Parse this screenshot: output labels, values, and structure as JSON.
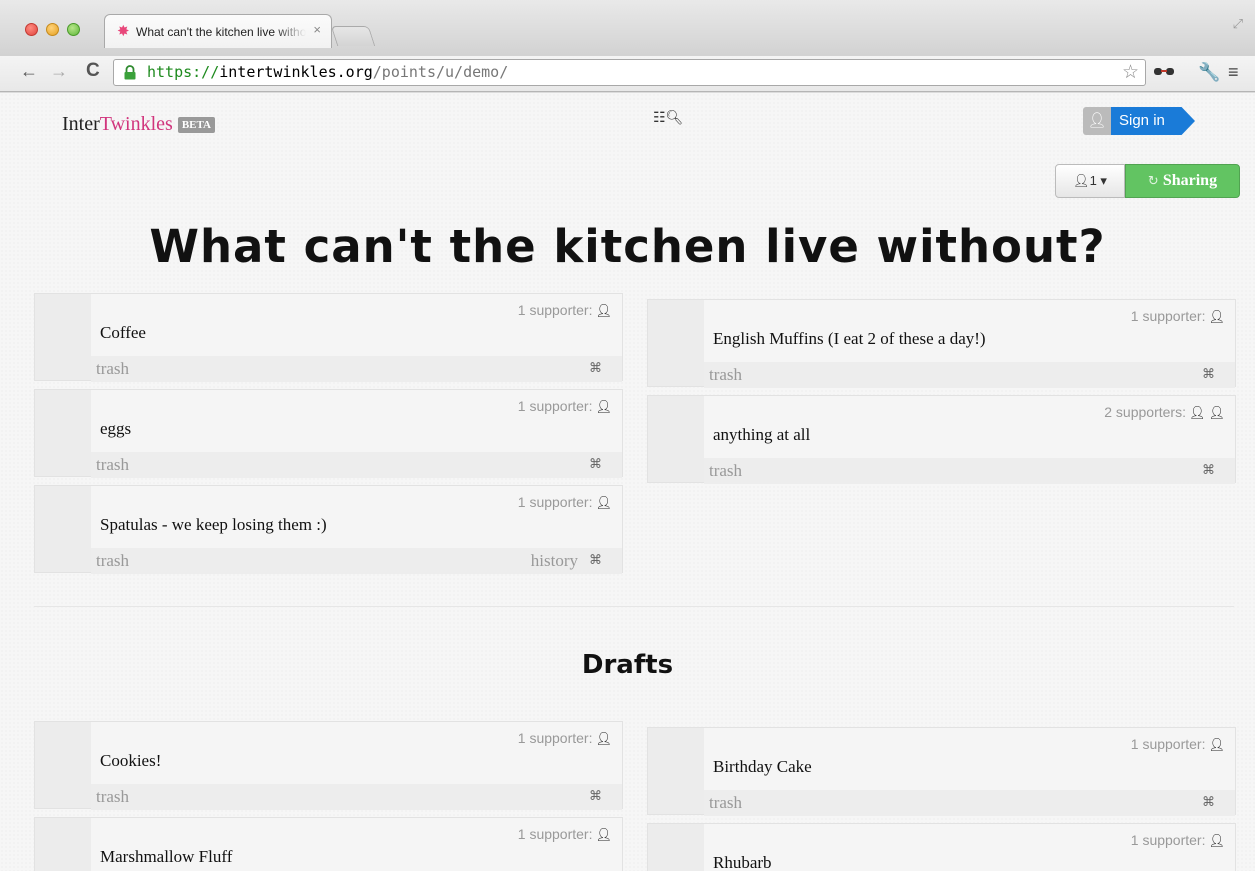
{
  "browser": {
    "tab_title": "What can't the kitchen live without?",
    "tab_close": "×",
    "url_scheme": "https://",
    "url_host": "intertwinkles.org",
    "url_path": "/points/u/demo/"
  },
  "header": {
    "brand_inter": "Inter",
    "brand_twinkles": "Twinkles",
    "beta_badge": "BETA",
    "sign_in": "Sign in",
    "users_count": "1",
    "sharing_label": "Sharing"
  },
  "main": {
    "title": "What can't the kitchen live without?",
    "drafts_title": "Drafts"
  },
  "labels": {
    "trash": "trash",
    "history": "history"
  },
  "approved_points": [
    {
      "text": "Coffee",
      "supporters": "1 supporter:",
      "count": 1,
      "history": false
    },
    {
      "text": "English Muffins (I eat 2 of these a day!)",
      "supporters": "1 supporter:",
      "count": 1,
      "history": false
    },
    {
      "text": "eggs",
      "supporters": "1 supporter:",
      "count": 1,
      "history": false
    },
    {
      "text": "anything at all",
      "supporters": "2 supporters:",
      "count": 2,
      "history": false
    },
    {
      "text": "Spatulas - we keep losing them :)",
      "supporters": "1 supporter:",
      "count": 1,
      "history": true
    }
  ],
  "draft_points": [
    {
      "text": "Cookies!",
      "supporters": "1 supporter:",
      "count": 1,
      "history": false
    },
    {
      "text": "Birthday Cake",
      "supporters": "1 supporter:",
      "count": 1,
      "history": false
    },
    {
      "text": "Marshmallow Fluff",
      "supporters": "1 supporter:",
      "count": 1,
      "history": false
    },
    {
      "text": "Rhubarb",
      "supporters": "1 supporter:",
      "count": 1,
      "history": false
    }
  ],
  "colors": {
    "brand_accent": "#d1357d",
    "sign_in_blue": "#1a7bd8",
    "sharing_green": "#62c462",
    "url_green": "#1d8a1d"
  },
  "icons": {
    "tab_favicon": "intertwinkles-star-icon",
    "lock": "lock-icon",
    "search": "list-search-icon",
    "person": "person-icon",
    "move": "move-icon"
  }
}
